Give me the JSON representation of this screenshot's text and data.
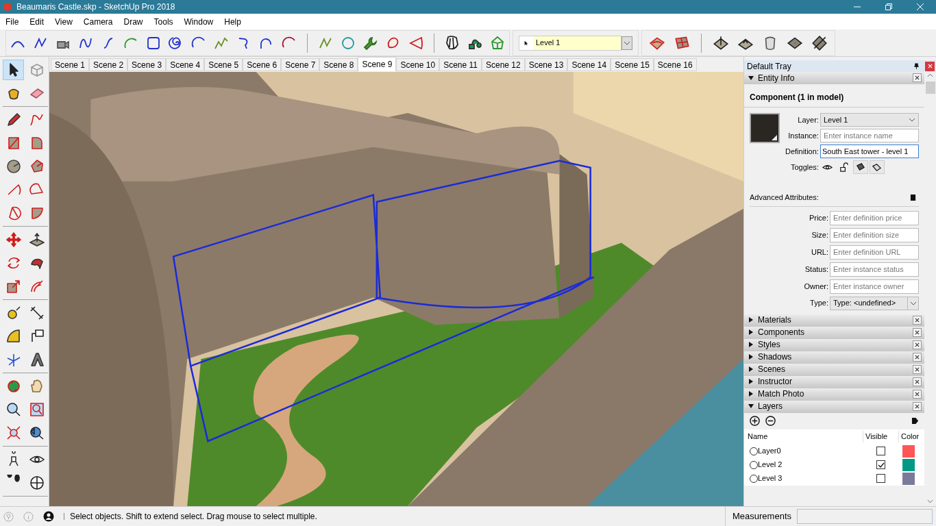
{
  "window": {
    "title": "Beaumaris Castle.skp - SketchUp Pro 2018"
  },
  "menu": [
    "File",
    "Edit",
    "View",
    "Camera",
    "Draw",
    "Tools",
    "Window",
    "Help"
  ],
  "layer_toolbar": {
    "value": "Level 1"
  },
  "scene_tabs": [
    {
      "label": "Scene 1",
      "selected": false
    },
    {
      "label": "Scene 2",
      "selected": false
    },
    {
      "label": "Scene 3",
      "selected": false
    },
    {
      "label": "Scene 4",
      "selected": false
    },
    {
      "label": "Scene 5",
      "selected": false
    },
    {
      "label": "Scene 6",
      "selected": false
    },
    {
      "label": "Scene 7",
      "selected": false
    },
    {
      "label": "Scene 8",
      "selected": false
    },
    {
      "label": "Scene 9",
      "selected": true
    },
    {
      "label": "Scene 10",
      "selected": false
    },
    {
      "label": "Scene 11",
      "selected": false
    },
    {
      "label": "Scene 12",
      "selected": false
    },
    {
      "label": "Scene 13",
      "selected": false
    },
    {
      "label": "Scene 14",
      "selected": false
    },
    {
      "label": "Scene 15",
      "selected": false
    },
    {
      "label": "Scene 16",
      "selected": false
    }
  ],
  "left_toolbar": {
    "tools": [
      {
        "selected": true
      },
      {
        "selected": false
      },
      {
        "selected": false
      },
      {
        "selected": false
      },
      {
        "selected": false
      },
      {
        "selected": false
      },
      {
        "selected": false
      },
      {
        "selected": false
      },
      {
        "selected": false
      },
      {
        "selected": false
      },
      {
        "selected": false
      },
      {
        "selected": false
      },
      {
        "selected": false
      },
      {
        "selected": false
      },
      {
        "selected": false
      },
      {
        "selected": false
      },
      {
        "selected": false
      },
      {
        "selected": false
      },
      {
        "selected": false
      },
      {
        "selected": false
      },
      {
        "selected": false
      },
      {
        "selected": false
      },
      {
        "selected": false
      },
      {
        "selected": false
      },
      {
        "selected": false
      },
      {
        "selected": false
      },
      {
        "selected": false
      },
      {
        "selected": false
      },
      {
        "selected": false
      },
      {
        "selected": false
      },
      {
        "selected": false
      },
      {
        "selected": false
      },
      {
        "selected": false
      },
      {
        "selected": false
      },
      {
        "selected": false
      },
      {
        "selected": false
      }
    ]
  },
  "tray": {
    "title": "Default Tray",
    "entity_info": {
      "title": "Entity Info",
      "expanded": true,
      "heading": "Component (1 in model)",
      "layer": {
        "label": "Layer:",
        "value": "Level 1"
      },
      "instance": {
        "label": "Instance:",
        "placeholder": "Enter instance name"
      },
      "definition": {
        "label": "Definition:",
        "value": "South East tower - level 1"
      },
      "toggles_label": "Toggles:",
      "advanced_title": "Advanced Attributes:",
      "attributes": [
        {
          "label": "Price:",
          "placeholder": "Enter definition price"
        },
        {
          "label": "Size:",
          "placeholder": "Enter definition size"
        },
        {
          "label": "URL:",
          "placeholder": "Enter definition URL"
        },
        {
          "label": "Status:",
          "placeholder": "Enter instance status"
        },
        {
          "label": "Owner:",
          "placeholder": "Enter instance owner"
        }
      ],
      "type": {
        "label": "Type:",
        "value": "Type: <undefined>"
      }
    },
    "panels": [
      {
        "title": "Materials",
        "expanded": false
      },
      {
        "title": "Components",
        "expanded": false
      },
      {
        "title": "Styles",
        "expanded": false
      },
      {
        "title": "Shadows",
        "expanded": false
      },
      {
        "title": "Scenes",
        "expanded": false
      },
      {
        "title": "Instructor",
        "expanded": false
      },
      {
        "title": "Match Photo",
        "expanded": false
      },
      {
        "title": "Layers",
        "expanded": true
      }
    ],
    "layers": {
      "columns": [
        "Name",
        "Visible",
        "Color"
      ],
      "rows": [
        {
          "name": "Layer0",
          "selected": false,
          "visible": false,
          "color": "#ff5555"
        },
        {
          "name": "Level 2",
          "selected": false,
          "visible": true,
          "color": "#009a84"
        },
        {
          "name": "Level 3",
          "selected": false,
          "visible": false,
          "color": "#7a7a9a"
        }
      ]
    }
  },
  "status_bar": {
    "message": "Select objects. Shift to extend select. Drag mouse to select multiple.",
    "measurements_label": "Measurements"
  }
}
